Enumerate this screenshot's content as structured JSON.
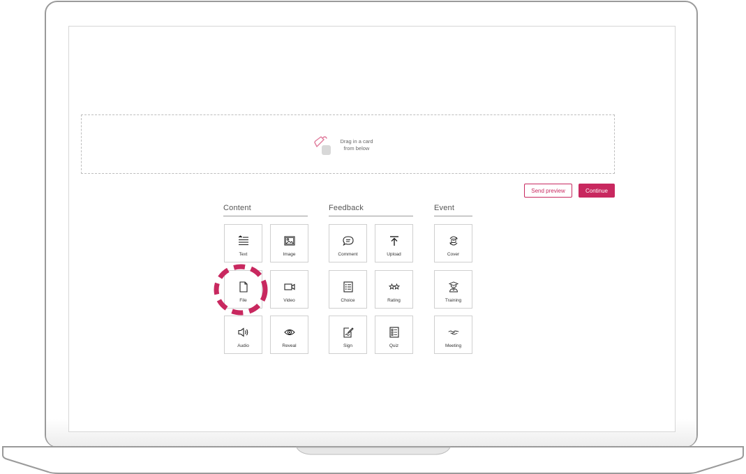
{
  "dropzone": {
    "line1": "Drag in a card",
    "line2": "from below"
  },
  "actions": {
    "send_preview": "Send preview",
    "continue": "Continue"
  },
  "sections": [
    {
      "title": "Content",
      "cards": [
        "Text",
        "Image",
        "File",
        "Video",
        "Audio",
        "Reveal"
      ]
    },
    {
      "title": "Feedback",
      "cards": [
        "Comment",
        "Upload",
        "Choice",
        "Rating",
        "Sign",
        "Quiz"
      ]
    },
    {
      "title": "Event",
      "cards": [
        "Cover",
        "Training",
        "Meeting"
      ]
    }
  ],
  "colors": {
    "accent": "#c8285f",
    "border": "#cfcfcf"
  },
  "icons": {
    "text": "text-align-icon",
    "image": "image-icon",
    "file": "file-icon",
    "video": "video-camera-icon",
    "audio": "speaker-icon",
    "reveal": "eye-icon",
    "comment": "speech-bubble-icon",
    "upload": "upload-arrow-icon",
    "choice": "list-icon",
    "rating": "stars-icon",
    "sign": "signature-icon",
    "quiz": "checklist-icon",
    "cover": "cover-icon",
    "training": "graduate-icon",
    "meeting": "handshake-icon",
    "drag": "drag-hand-icon"
  }
}
